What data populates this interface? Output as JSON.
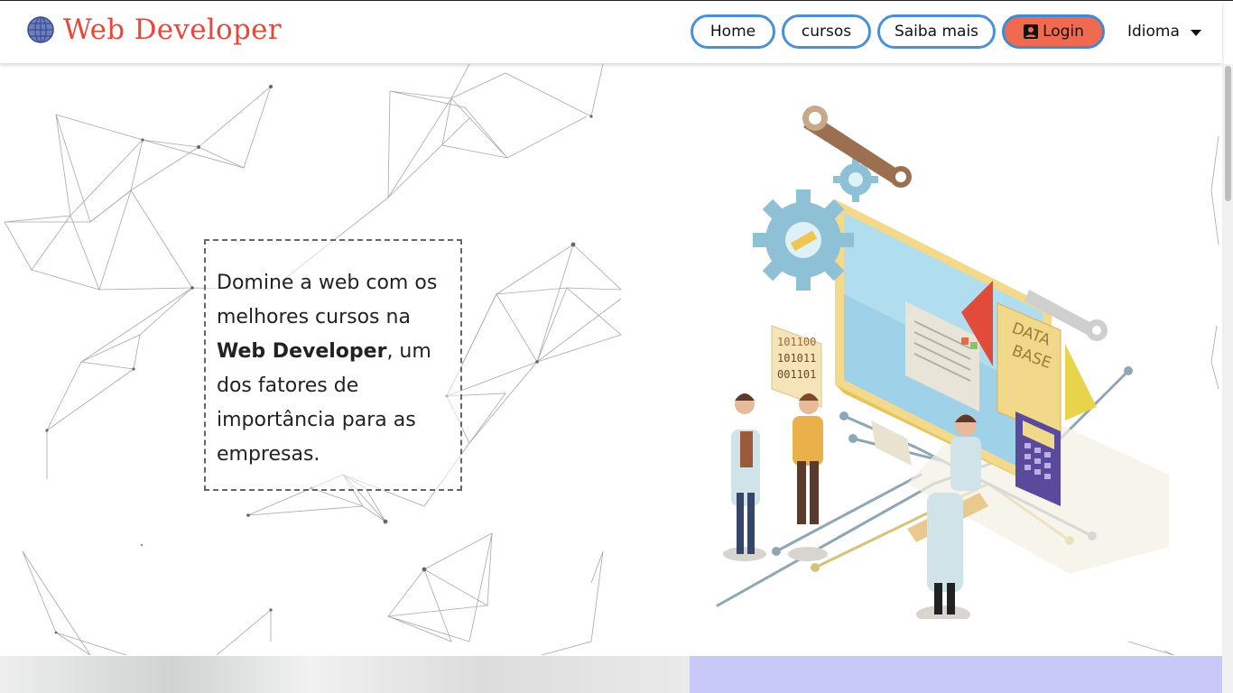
{
  "header": {
    "brand": "Web Developer",
    "brand_color": "#e8473a",
    "logo_icon": "globe-icon"
  },
  "nav": {
    "home": "Home",
    "cursos": "cursos",
    "saiba_mais": "Saiba mais",
    "login": "Login",
    "login_icon": "contact-card-icon",
    "idioma": "Idioma"
  },
  "hero": {
    "text_before": "Domine a web com os melhores cursos na ",
    "text_bold": "Web Developer",
    "text_after": ", um dos fatores de importância para as empresas."
  },
  "illustration": {
    "database_label_line1": "DATA",
    "database_label_line2": "BASE",
    "binary_line1": "101100",
    "binary_line2": "101011",
    "binary_line3": "001101"
  },
  "colors": {
    "nav_border": "#4a90d9",
    "login_bg": "#f06a4f",
    "bottom_right_bg": "#c9c9f9"
  }
}
